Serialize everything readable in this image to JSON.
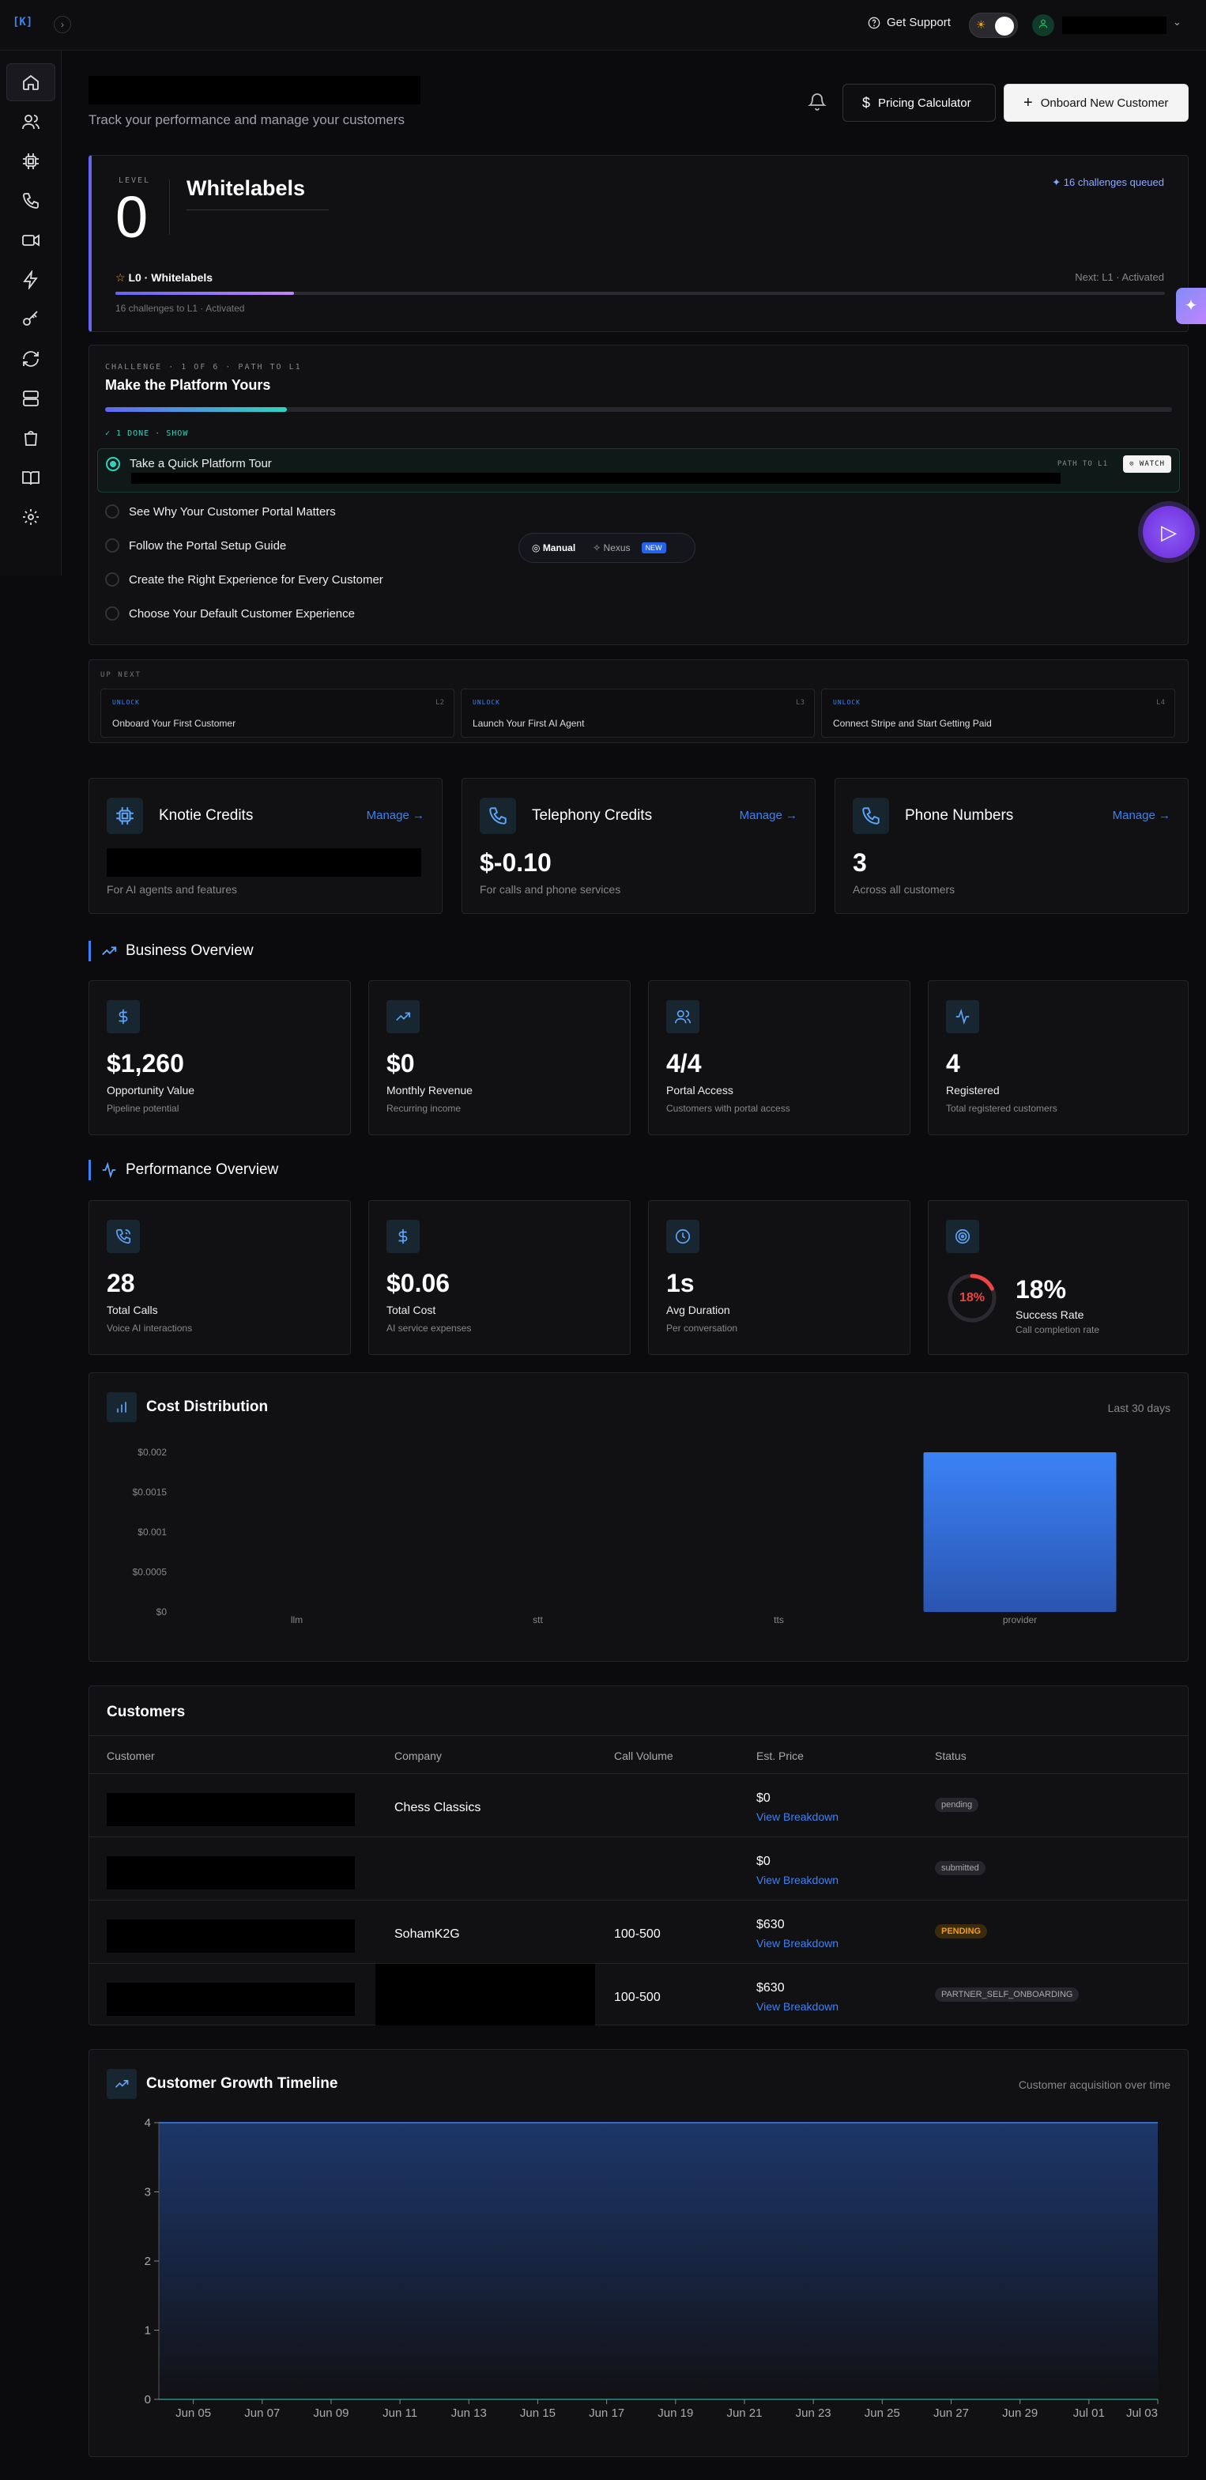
{
  "topbar": {
    "logo": "[K]",
    "support": "Get Support",
    "sun_icon": "sun-icon"
  },
  "header": {
    "subtitle": "Track your performance and manage your customers",
    "pricing": "Pricing Calculator",
    "onboard": "Onboard New Customer"
  },
  "level": {
    "label": "LEVEL",
    "number": "0",
    "title": "Whitelabels",
    "queued": "16 challenges queued",
    "name": "L0 · Whitelabels",
    "next": "Next: L1 · Activated",
    "sub": "16 challenges to L1 · Activated",
    "progress": 0.17
  },
  "challenge": {
    "label": "CHALLENGE · 1 OF 6 · PATH TO L1",
    "title": "Make the Platform Yours",
    "progress": 0.17,
    "done": "✓ 1 DONE · SHOW",
    "items": [
      "Take a Quick Platform Tour",
      "See Why Your Customer Portal Matters",
      "Follow the Portal Setup Guide",
      "Create the Right Experience for Every Customer",
      "Choose Your Default Customer Experience"
    ],
    "path_tag": "PATH TO L1",
    "watch": "WATCH"
  },
  "mode": {
    "manual": "Manual",
    "nexus": "Nexus",
    "new": "NEW"
  },
  "upnext": {
    "label": "UP NEXT",
    "items": [
      {
        "unlock": "UNLOCK",
        "level": "L2",
        "title": "Onboard Your First Customer"
      },
      {
        "unlock": "UNLOCK",
        "level": "L3",
        "title": "Launch Your First AI Agent"
      },
      {
        "unlock": "UNLOCK",
        "level": "L4",
        "title": "Connect Stripe and Start Getting Paid"
      }
    ]
  },
  "credits": [
    {
      "title": "Knotie Credits",
      "manage": "Manage →",
      "value": "",
      "desc": "For AI agents and features"
    },
    {
      "title": "Telephony Credits",
      "manage": "Manage →",
      "value": "$-0.10",
      "desc": "For calls and phone services"
    },
    {
      "title": "Phone Numbers",
      "manage": "Manage →",
      "value": "3",
      "desc": "Across all customers"
    }
  ],
  "business": {
    "title": "Business Overview",
    "stats": [
      {
        "value": "$1,260",
        "label": "Opportunity Value",
        "sub": "Pipeline potential"
      },
      {
        "value": "$0",
        "label": "Monthly Revenue",
        "sub": "Recurring income"
      },
      {
        "value": "4/4",
        "label": "Portal Access",
        "sub": "Customers with portal access"
      },
      {
        "value": "4",
        "label": "Registered",
        "sub": "Total registered customers"
      }
    ]
  },
  "performance": {
    "title": "Performance Overview",
    "stats": [
      {
        "value": "28",
        "label": "Total Calls",
        "sub": "Voice AI interactions"
      },
      {
        "value": "$0.06",
        "label": "Total Cost",
        "sub": "AI service expenses"
      },
      {
        "value": "1s",
        "label": "Avg Duration",
        "sub": "Per conversation"
      },
      {
        "value": "18%",
        "label": "Success Rate",
        "sub": "Call completion rate",
        "ring_value": "18%",
        "ring_fraction": 0.18
      }
    ]
  },
  "cost": {
    "title": "Cost Distribution",
    "period": "Last 30 days"
  },
  "customers": {
    "title": "Customers",
    "headers": [
      "Customer",
      "Company",
      "Call Volume",
      "Est. Price",
      "Status"
    ],
    "rows": [
      {
        "company": "Chess Classics",
        "volume": "",
        "price": "$0",
        "breakdown": "View Breakdown",
        "status": "pending"
      },
      {
        "company": "",
        "volume": "",
        "price": "$0",
        "breakdown": "View Breakdown",
        "status": "submitted"
      },
      {
        "company": "SohamK2G",
        "volume": "100-500",
        "price": "$630",
        "breakdown": "View Breakdown",
        "status": "PENDING"
      },
      {
        "company": "",
        "volume": "100-500",
        "price": "$630",
        "breakdown": "View Breakdown",
        "status": "PARTNER_SELF_ONBOARDING"
      }
    ]
  },
  "growth": {
    "title": "Customer Growth Timeline",
    "sub": "Customer acquisition over time"
  },
  "chart_data": [
    {
      "type": "bar",
      "title": "Cost Distribution",
      "categories": [
        "llm",
        "stt",
        "tts",
        "provider"
      ],
      "values": [
        0,
        0,
        0,
        0.002
      ],
      "yticks": [
        "$0",
        "$0.0005",
        "$0.001",
        "$0.0015",
        "$0.002"
      ],
      "ylim": [
        0,
        0.002
      ],
      "color": "#3b82f6"
    },
    {
      "type": "area",
      "title": "Customer Growth Timeline",
      "x": [
        "Jun 04",
        "Jun 05",
        "Jun 06",
        "Jun 07",
        "Jun 08",
        "Jun 09",
        "Jun 10",
        "Jun 11",
        "Jun 12",
        "Jun 13",
        "Jun 14",
        "Jun 15",
        "Jun 16",
        "Jun 17",
        "Jun 18",
        "Jun 19",
        "Jun 20",
        "Jun 21",
        "Jun 22",
        "Jun 23",
        "Jun 24",
        "Jun 25",
        "Jun 26",
        "Jun 27",
        "Jun 28",
        "Jun 29",
        "Jun 30",
        "Jul 01",
        "Jul 02",
        "Jul 03"
      ],
      "values": [
        4,
        4,
        4,
        4,
        4,
        4,
        4,
        4,
        4,
        4,
        4,
        4,
        4,
        4,
        4,
        4,
        4,
        4,
        4,
        4,
        4,
        4,
        4,
        4,
        4,
        4,
        4,
        4,
        4,
        4
      ],
      "xticks": [
        "Jun 05",
        "Jun 07",
        "Jun 09",
        "Jun 11",
        "Jun 13",
        "Jun 15",
        "Jun 17",
        "Jun 19",
        "Jun 21",
        "Jun 23",
        "Jun 25",
        "Jun 27",
        "Jun 29",
        "Jul 01",
        "Jul 03"
      ],
      "yticks": [
        "0",
        "1",
        "2",
        "3",
        "4"
      ],
      "ylim": [
        0,
        4
      ],
      "color": "#3b82f6"
    }
  ]
}
